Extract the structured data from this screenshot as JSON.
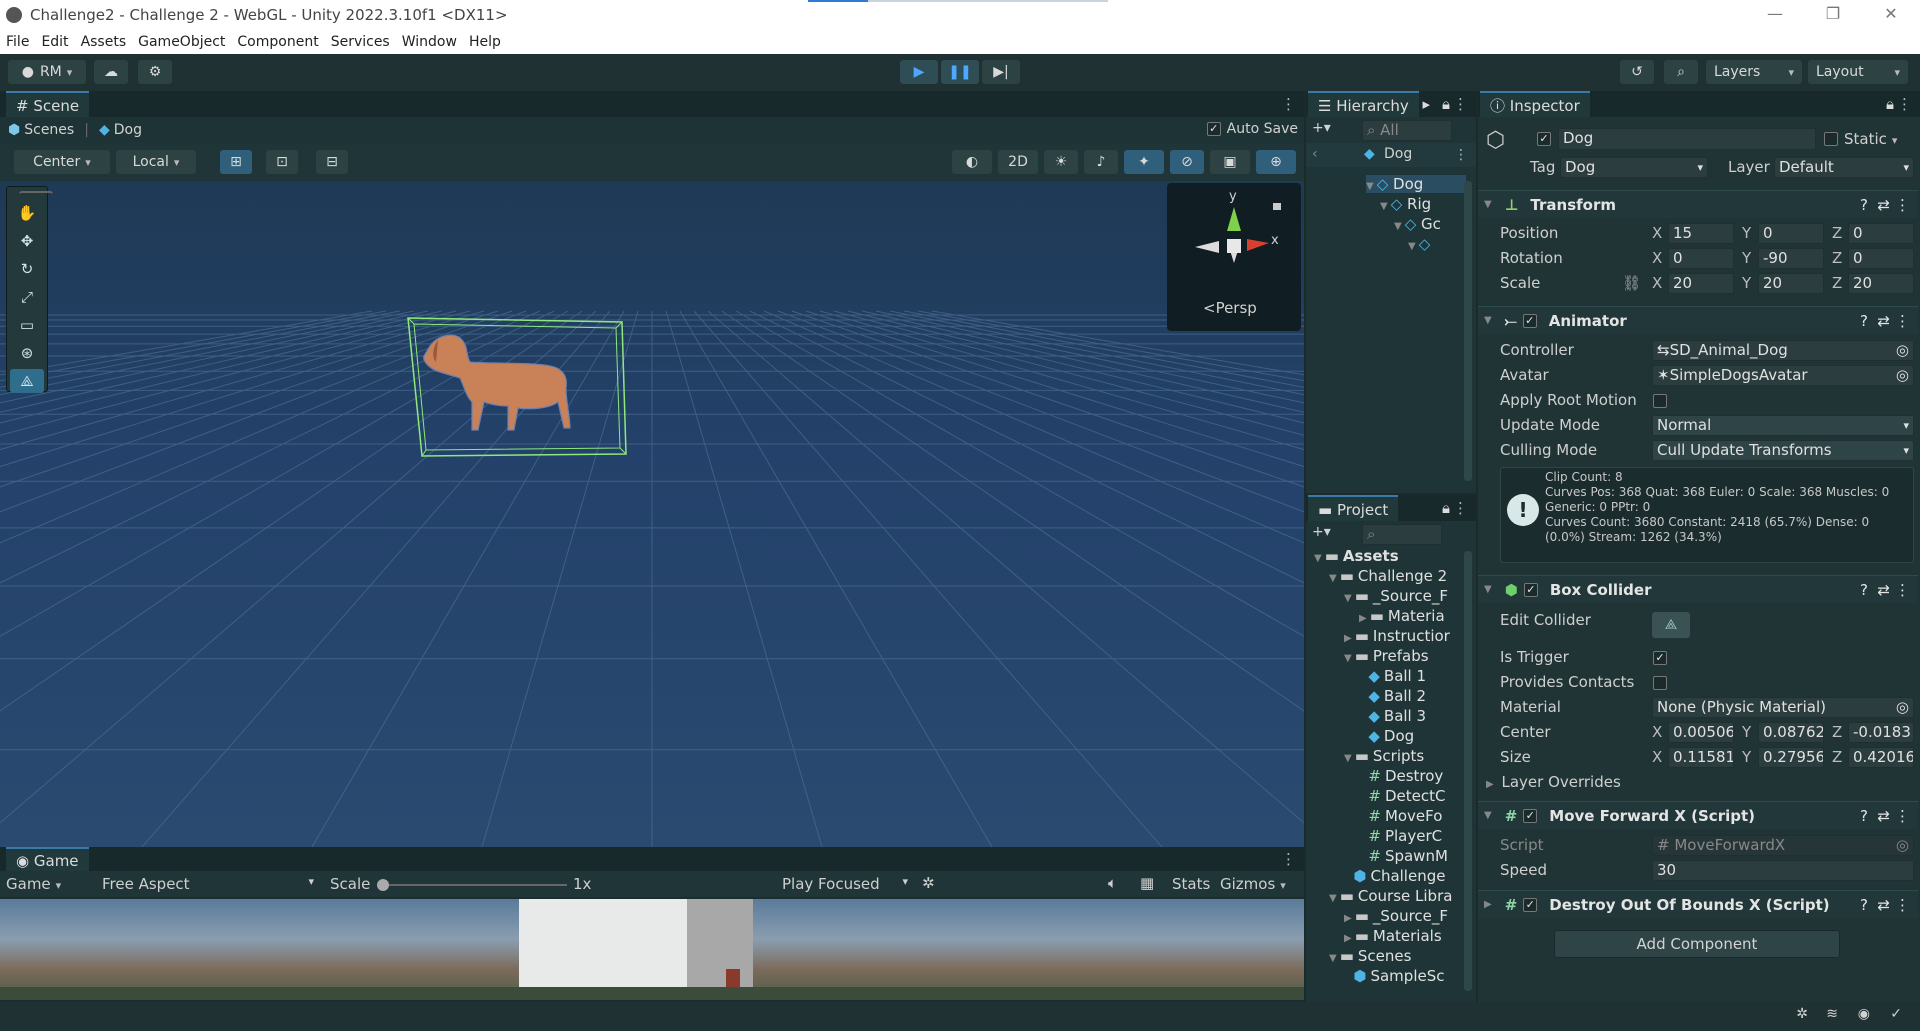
{
  "window": {
    "title": "Challenge2 - Challenge 2 - WebGL - Unity 2022.3.10f1 <DX11>"
  },
  "menu": [
    "File",
    "Edit",
    "Assets",
    "GameObject",
    "Component",
    "Services",
    "Window",
    "Help"
  ],
  "toolbar": {
    "account": "RM",
    "layers": "Layers",
    "layout": "Layout"
  },
  "scene": {
    "tab": "Scene",
    "breadcrumb_root": "Scenes",
    "breadcrumb_object": "Dog",
    "auto_save": "Auto Save",
    "pivot": "Center",
    "space": "Local",
    "btn_2d": "2D",
    "persp": "<Persp",
    "gizmo_y": "y",
    "gizmo_x": "x"
  },
  "game": {
    "tab": "Game",
    "display": "Game",
    "aspect": "Free Aspect",
    "scale_label": "Scale",
    "scale_value": "1x",
    "play_mode": "Play Focused",
    "stats": "Stats",
    "gizmos": "Gizmos"
  },
  "hierarchy": {
    "tab": "Hierarchy",
    "search_placeholder": "All",
    "root": "Dog",
    "items": [
      {
        "label": "Dog"
      },
      {
        "label": "Rig"
      },
      {
        "label": "Gc"
      }
    ]
  },
  "project": {
    "tab": "Project",
    "items": [
      "Assets",
      "Challenge 2",
      "_Source_F",
      "Materia",
      "Instructior",
      "Prefabs",
      "Ball 1",
      "Ball 2",
      "Ball 3",
      "Dog",
      "Scripts",
      "Destroy",
      "DetectC",
      "MoveFo",
      "PlayerC",
      "SpawnM",
      "Challenge",
      "Course Libra",
      "_Source_F",
      "Materials",
      "Scenes",
      "SampleSc"
    ]
  },
  "inspector": {
    "tab": "Inspector",
    "object_name": "Dog",
    "static": "Static",
    "tag_label": "Tag",
    "tag_value": "Dog",
    "layer_label": "Layer",
    "layer_value": "Default",
    "transform": {
      "title": "Transform",
      "position_label": "Position",
      "position": [
        "15",
        "0",
        "0"
      ],
      "rotation_label": "Rotation",
      "rotation": [
        "0",
        "-90",
        "0"
      ],
      "scale_label": "Scale",
      "scale": [
        "20",
        "20",
        "20"
      ]
    },
    "axes": [
      "X",
      "Y",
      "Z"
    ],
    "animator": {
      "title": "Animator",
      "controller_label": "Controller",
      "controller": "SD_Animal_Dog",
      "avatar_label": "Avatar",
      "avatar": "SimpleDogsAvatar",
      "root_motion_label": "Apply Root Motion",
      "update_mode_label": "Update Mode",
      "update_mode": "Normal",
      "culling_label": "Culling Mode",
      "culling": "Cull Update Transforms",
      "info": [
        "Clip Count: 8",
        "Curves Pos: 368 Quat: 368 Euler: 0 Scale: 368 Muscles: 0",
        "Generic: 0 PPtr: 0",
        "Curves Count: 3680 Constant: 2418 (65.7%) Dense: 0",
        "(0.0%) Stream: 1262 (34.3%)"
      ]
    },
    "box_collider": {
      "title": "Box Collider",
      "edit_label": "Edit Collider",
      "trigger_label": "Is Trigger",
      "contacts_label": "Provides Contacts",
      "material_label": "Material",
      "material": "None (Physic Material)",
      "center_label": "Center",
      "center": [
        "0.00506",
        "0.08762",
        "-0.0183"
      ],
      "size_label": "Size",
      "size": [
        "0.11581",
        "0.27956",
        "0.42016"
      ],
      "overrides_label": "Layer Overrides"
    },
    "move_forward": {
      "title": "Move Forward X (Script)",
      "script_label": "Script",
      "script": "MoveForwardX",
      "speed_label": "Speed",
      "speed": "30"
    },
    "destroy": {
      "title": "Destroy Out Of Bounds X (Script)"
    },
    "add_component": "Add Component"
  }
}
